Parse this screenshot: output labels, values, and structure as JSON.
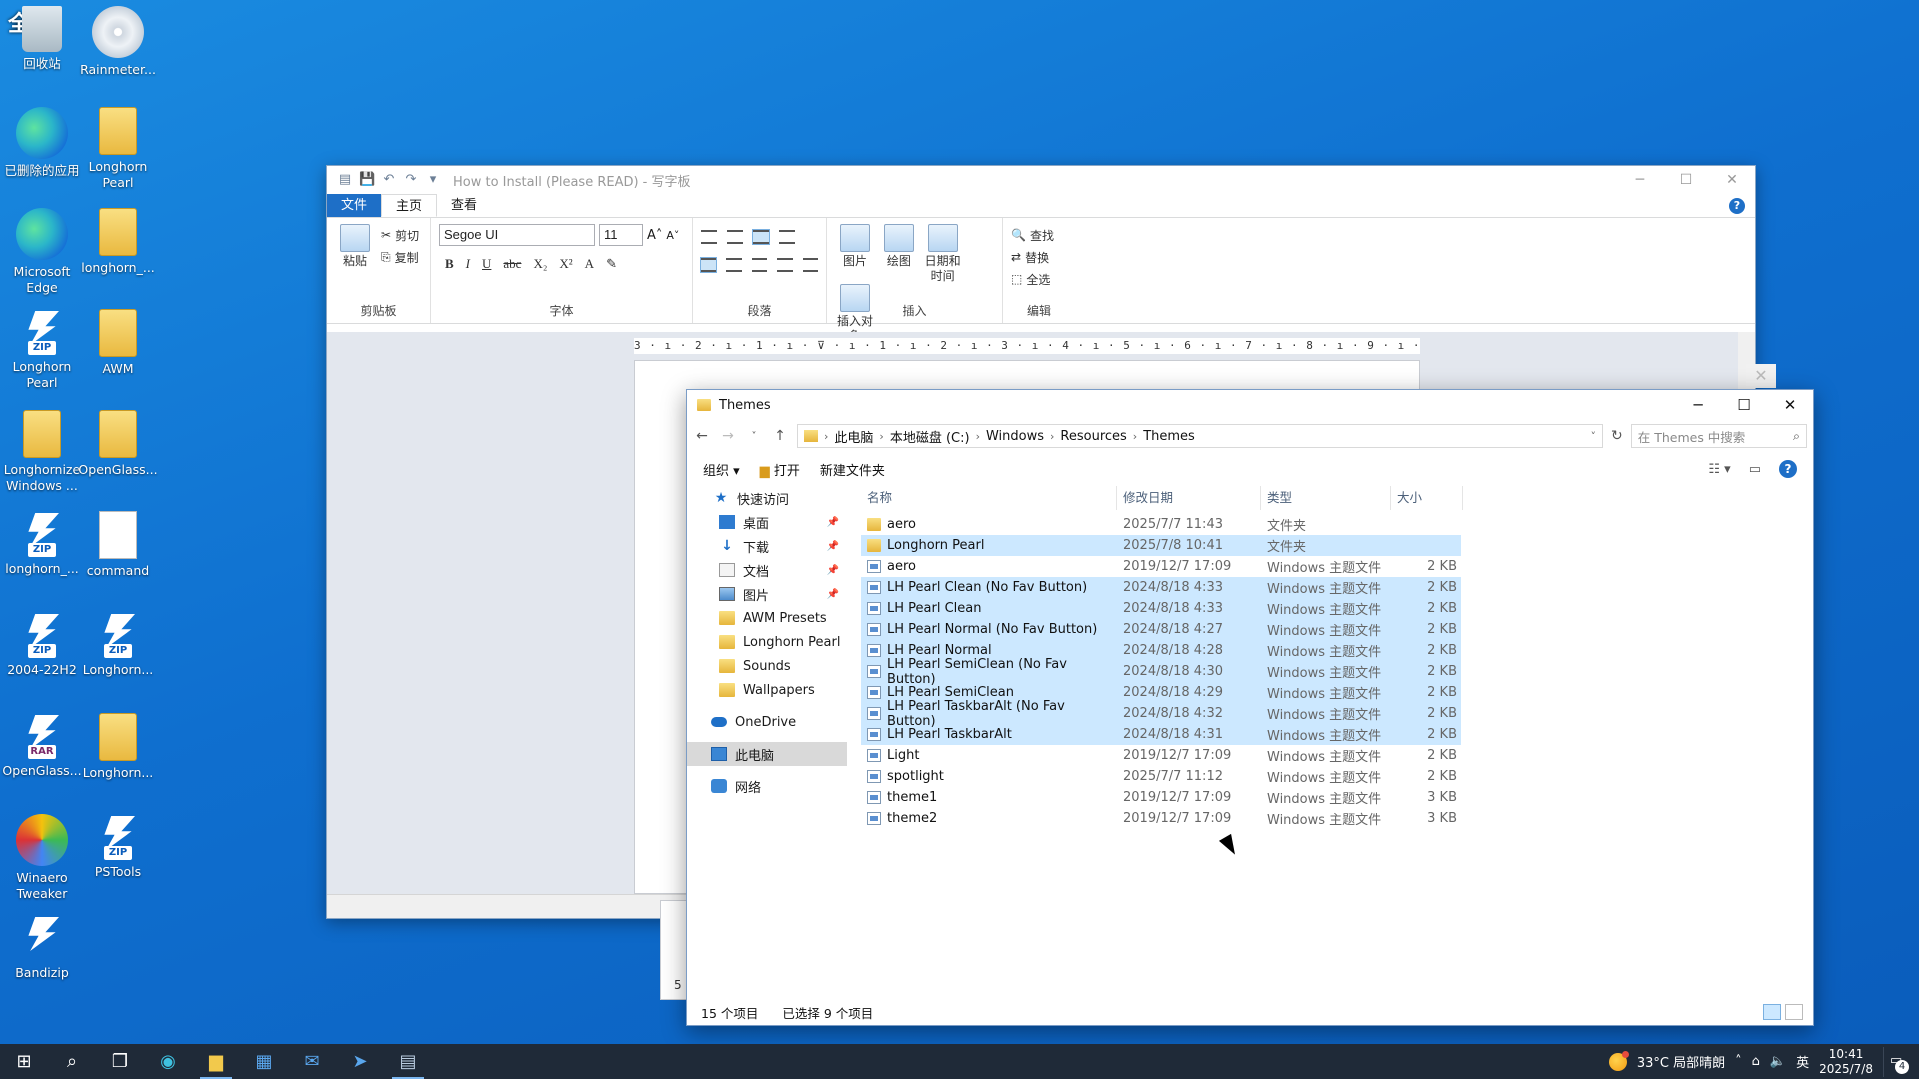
{
  "desktop": {
    "fullscreen_tag": "全屏",
    "icons": [
      {
        "label": "回收站",
        "icon": "recycle-bin-icon"
      },
      {
        "label": "Rainmeter...",
        "icon": "rainmeter-icon"
      },
      {
        "label": "已删除的应用",
        "icon": "edge-icon"
      },
      {
        "label": "Longhorn Pearl",
        "icon": "folder-icon"
      },
      {
        "label": "Microsoft Edge",
        "icon": "edge-icon"
      },
      {
        "label": "longhorn_...",
        "icon": "folder-icon"
      },
      {
        "label": "Longhorn Pearl",
        "icon": "zip-icon"
      },
      {
        "label": "AWM",
        "icon": "folder-icon"
      },
      {
        "label": "Longhornize Windows ...",
        "icon": "folder-icon"
      },
      {
        "label": "OpenGlass...",
        "icon": "folder-icon"
      },
      {
        "label": "longhorn_...",
        "icon": "zip-icon"
      },
      {
        "label": "command",
        "icon": "document-icon"
      },
      {
        "label": "2004-22H2",
        "icon": "zip-icon"
      },
      {
        "label": "Longhorn...",
        "icon": "zip-icon"
      },
      {
        "label": "OpenGlass...",
        "icon": "rar-icon"
      },
      {
        "label": "Longhorn...",
        "icon": "folder-icon"
      },
      {
        "label": "Winaero Tweaker",
        "icon": "winaero-icon"
      },
      {
        "label": "PSTools",
        "icon": "zip-icon"
      },
      {
        "label": "Bandizip",
        "icon": "bandizip-icon"
      }
    ],
    "zip_tag": "ZIP",
    "rar_tag": "RAR"
  },
  "wordpad": {
    "title": "How to Install (Please READ) - 写字板",
    "tabs": {
      "file": "文件",
      "home": "主页",
      "view": "查看"
    },
    "clipboard": {
      "paste": "粘贴",
      "cut": "剪切",
      "copy": "复制",
      "label": "剪贴板"
    },
    "font": {
      "family": "Segoe UI",
      "size": "11",
      "label": "字体"
    },
    "format_buttons": [
      "B",
      "I",
      "U",
      "abc",
      "X₂",
      "X²",
      "A",
      "✎"
    ],
    "paragraph_label": "段落",
    "insert": {
      "picture": "图片",
      "paint": "绘图",
      "datetime": "日期和时间",
      "object": "插入对象",
      "label": "插入"
    },
    "edit": {
      "find": "查找",
      "replace": "替换",
      "select_all": "全选",
      "label": "编辑"
    },
    "ruler_text": "3 · ı · 2 · ı · 1 · ı · ⊽ · ı · 1 · ı · 2 · ı · 3 · ı · 4 · ı · 5 · ı · 6 · ı · 7 · ı · 8 · ı · 9 · ı · 10 · ı · 11 · ı · 12 · ı · 13 · ı · 14 · ⊾ · 15 · ı · 16 · ı · 17 ·",
    "page_number": "5"
  },
  "explorer": {
    "title": "Themes",
    "path": [
      "此电脑",
      "本地磁盘 (C:)",
      "Windows",
      "Resources",
      "Themes"
    ],
    "search_placeholder": "在 Themes 中搜索",
    "commands": {
      "organize": "组织 ▾",
      "open": "打开",
      "new_folder": "新建文件夹"
    },
    "nav": {
      "quick_access": "快速访问",
      "desktop": "桌面",
      "downloads": "下载",
      "documents": "文档",
      "pictures": "图片",
      "awm_presets": "AWM Presets",
      "longhorn_pearl": "Longhorn Pearl",
      "sounds": "Sounds",
      "wallpapers": "Wallpapers",
      "onedrive": "OneDrive",
      "this_pc": "此电脑",
      "network": "网络"
    },
    "columns": {
      "name": "名称",
      "modified": "修改日期",
      "type": "类型",
      "size": "大小"
    },
    "files": [
      {
        "name": "aero",
        "modified": "2025/7/7 11:43",
        "type": "文件夹",
        "size": "",
        "kind": "folder",
        "selected": false
      },
      {
        "name": "Longhorn Pearl",
        "modified": "2025/7/8 10:41",
        "type": "文件夹",
        "size": "",
        "kind": "folder",
        "selected": true
      },
      {
        "name": "aero",
        "modified": "2019/12/7 17:09",
        "type": "Windows 主题文件",
        "size": "2 KB",
        "kind": "theme",
        "selected": false
      },
      {
        "name": "LH Pearl Clean (No Fav Button)",
        "modified": "2024/8/18 4:33",
        "type": "Windows 主题文件",
        "size": "2 KB",
        "kind": "theme",
        "selected": true
      },
      {
        "name": "LH Pearl Clean",
        "modified": "2024/8/18 4:33",
        "type": "Windows 主题文件",
        "size": "2 KB",
        "kind": "theme",
        "selected": true
      },
      {
        "name": "LH Pearl Normal (No Fav Button)",
        "modified": "2024/8/18 4:27",
        "type": "Windows 主题文件",
        "size": "2 KB",
        "kind": "theme",
        "selected": true
      },
      {
        "name": "LH Pearl Normal",
        "modified": "2024/8/18 4:28",
        "type": "Windows 主题文件",
        "size": "2 KB",
        "kind": "theme",
        "selected": true
      },
      {
        "name": "LH Pearl SemiClean (No Fav Button)",
        "modified": "2024/8/18 4:30",
        "type": "Windows 主题文件",
        "size": "2 KB",
        "kind": "theme",
        "selected": true
      },
      {
        "name": "LH Pearl SemiClean",
        "modified": "2024/8/18 4:29",
        "type": "Windows 主题文件",
        "size": "2 KB",
        "kind": "theme",
        "selected": true
      },
      {
        "name": "LH Pearl TaskbarAlt (No Fav Button)",
        "modified": "2024/8/18 4:32",
        "type": "Windows 主题文件",
        "size": "2 KB",
        "kind": "theme",
        "selected": true
      },
      {
        "name": "LH Pearl TaskbarAlt",
        "modified": "2024/8/18 4:31",
        "type": "Windows 主题文件",
        "size": "2 KB",
        "kind": "theme",
        "selected": true
      },
      {
        "name": "Light",
        "modified": "2019/12/7 17:09",
        "type": "Windows 主题文件",
        "size": "2 KB",
        "kind": "theme",
        "selected": false
      },
      {
        "name": "spotlight",
        "modified": "2025/7/7 11:12",
        "type": "Windows 主题文件",
        "size": "2 KB",
        "kind": "theme",
        "selected": false
      },
      {
        "name": "theme1",
        "modified": "2019/12/7 17:09",
        "type": "Windows 主题文件",
        "size": "3 KB",
        "kind": "theme",
        "selected": false
      },
      {
        "name": "theme2",
        "modified": "2019/12/7 17:09",
        "type": "Windows 主题文件",
        "size": "3 KB",
        "kind": "theme",
        "selected": false
      }
    ],
    "status": {
      "count": "15 个项目",
      "selected": "已选择 9 个项目"
    }
  },
  "taskbar": {
    "weather": "33°C 局部晴朗",
    "ime": "英",
    "time": "10:41",
    "date": "2025/7/8",
    "notification_count": "4"
  }
}
